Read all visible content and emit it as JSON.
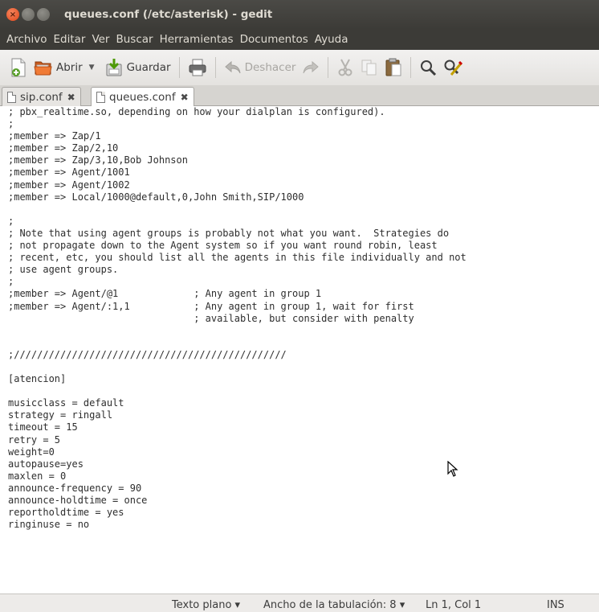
{
  "window": {
    "title": "queues.conf (/etc/asterisk) - gedit"
  },
  "menu": [
    "Archivo",
    "Editar",
    "Ver",
    "Buscar",
    "Herramientas",
    "Documentos",
    "Ayuda"
  ],
  "toolbar": {
    "open_label": "Abrir",
    "save_label": "Guardar",
    "undo_label": "Deshacer"
  },
  "tabs": [
    {
      "label": "sip.conf",
      "active": false
    },
    {
      "label": "queues.conf",
      "active": true
    }
  ],
  "editor": {
    "lines": [
      "; pbx_realtime.so, depending on how your dialplan is configured).",
      ";",
      ";member => Zap/1",
      ";member => Zap/2,10",
      ";member => Zap/3,10,Bob Johnson",
      ";member => Agent/1001",
      ";member => Agent/1002",
      ";member => Local/1000@default,0,John Smith,SIP/1000",
      "",
      ";",
      "; Note that using agent groups is probably not what you want.  Strategies do",
      "; not propagate down to the Agent system so if you want round robin, least",
      "; recent, etc, you should list all the agents in this file individually and not",
      "; use agent groups.",
      ";",
      ";member => Agent/@1             ; Any agent in group 1",
      ";member => Agent/:1,1           ; Any agent in group 1, wait for first",
      "                                ; available, but consider with penalty",
      "",
      "",
      ";///////////////////////////////////////////////",
      "",
      "[atencion]",
      "",
      "musicclass = default",
      "strategy = ringall",
      "timeout = 15",
      "retry = 5",
      "weight=0",
      "autopause=yes",
      "maxlen = 0",
      "announce-frequency = 90",
      "announce-holdtime = once",
      "reportholdtime = yes",
      "ringinuse = no"
    ]
  },
  "statusbar": {
    "language": "Texto plano ▾",
    "tab_width": "Ancho de la tabulación: 8 ▾",
    "position": "Ln 1, Col 1",
    "mode": "INS"
  }
}
